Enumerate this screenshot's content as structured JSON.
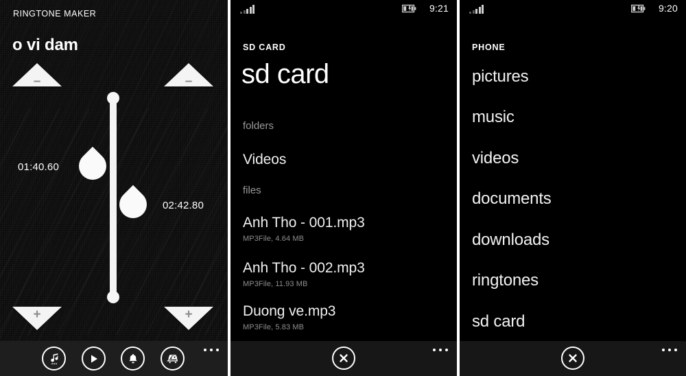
{
  "panels": {
    "ringtone_maker": {
      "app_title": "RINGTONE MAKER",
      "song_title": "o vi dam",
      "start_time": "01:40.60",
      "end_time": "02:42.80",
      "decrease_symbol": "–",
      "increase_symbol": "+",
      "appbar": {
        "icons": [
          {
            "name": "music-note-icon",
            "label": "music"
          },
          {
            "name": "play-icon",
            "label": "play"
          },
          {
            "name": "bell-icon",
            "label": "ringtone"
          },
          {
            "name": "save-music-icon",
            "label": "save"
          }
        ],
        "more_label": "..."
      }
    },
    "sd_card": {
      "status": {
        "time": "9:21",
        "signal": "signal-bars",
        "battery": "battery-charging"
      },
      "header": "SD CARD",
      "title": "sd card",
      "groups": [
        {
          "label": "folders",
          "items": [
            {
              "name": "Videos",
              "meta": ""
            }
          ]
        },
        {
          "label": "files",
          "items": [
            {
              "name": "Anh Tho - 001.mp3",
              "meta": "MP3File, 4.64 MB"
            },
            {
              "name": "Anh Tho - 002.mp3",
              "meta": "MP3File, 11.93 MB"
            },
            {
              "name": "Duong ve.mp3",
              "meta": "MP3File, 5.83 MB"
            }
          ]
        }
      ],
      "appbar": {
        "close_label": "close",
        "more_label": "..."
      }
    },
    "phone": {
      "status": {
        "time": "9:20",
        "signal": "signal-bars",
        "battery": "battery-charging"
      },
      "header": "PHONE",
      "items": [
        "pictures",
        "music",
        "videos",
        "documents",
        "downloads",
        "ringtones",
        "sd card"
      ],
      "appbar": {
        "close_label": "close",
        "more_label": "..."
      }
    }
  },
  "colors": {
    "background": "#000000",
    "panel1_background": "#0d0d0d",
    "appbar": "#1e1e1e",
    "accent_white": "#ffffff",
    "muted_text": "#9a9a9a",
    "sub_text": "#8e8e8e"
  }
}
